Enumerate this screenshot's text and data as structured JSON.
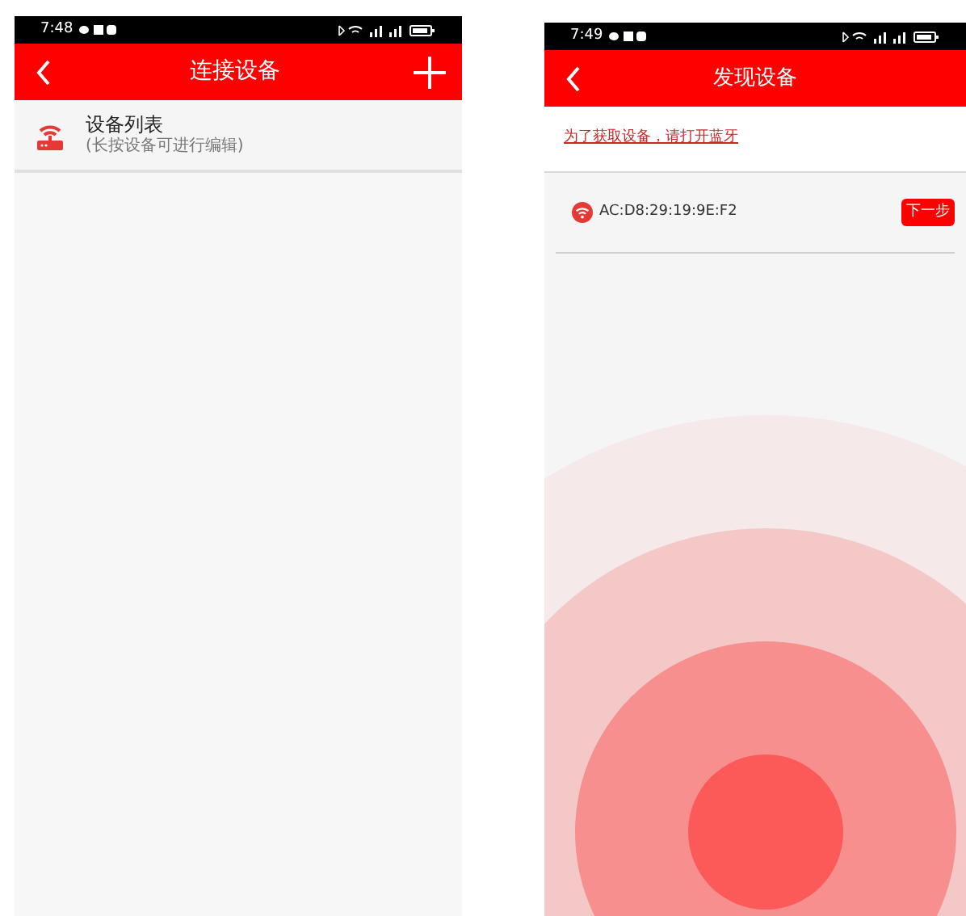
{
  "left_screen": {
    "status_bar": {
      "time": "7:48"
    },
    "header": {
      "title": "连接设备"
    },
    "device_list": {
      "title": "设备列表",
      "subtitle": "(长按设备可进行编辑)"
    }
  },
  "right_screen": {
    "status_bar": {
      "time": "7:49"
    },
    "header": {
      "title": "发现设备"
    },
    "notice": "为了获取设备，请打开蓝牙",
    "devices": [
      {
        "address": "AC:D8:29:19:9E:F2",
        "button": "下一步"
      }
    ]
  }
}
